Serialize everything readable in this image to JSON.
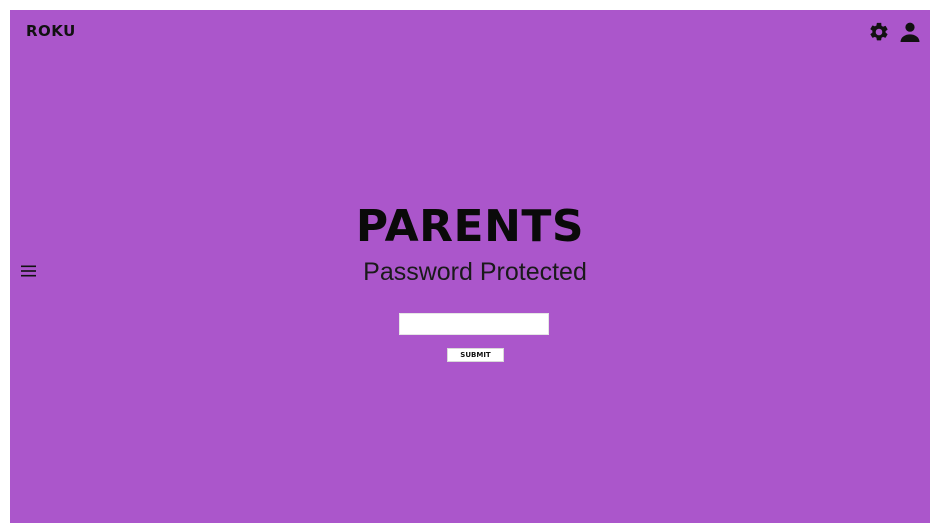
{
  "header": {
    "logo_text": "ROKU",
    "icons": [
      "gear-icon",
      "user-icon"
    ]
  },
  "menu": {
    "icon": "hamburger-menu-icon"
  },
  "main": {
    "title": "PARENTS",
    "subtitle": "Password Protected",
    "password_field": {
      "value": "",
      "placeholder": ""
    },
    "submit_label": "SUBMIT"
  },
  "colors": {
    "background": "#ab56cb",
    "text": "#0a0a0a",
    "input_background": "#ffffff"
  }
}
